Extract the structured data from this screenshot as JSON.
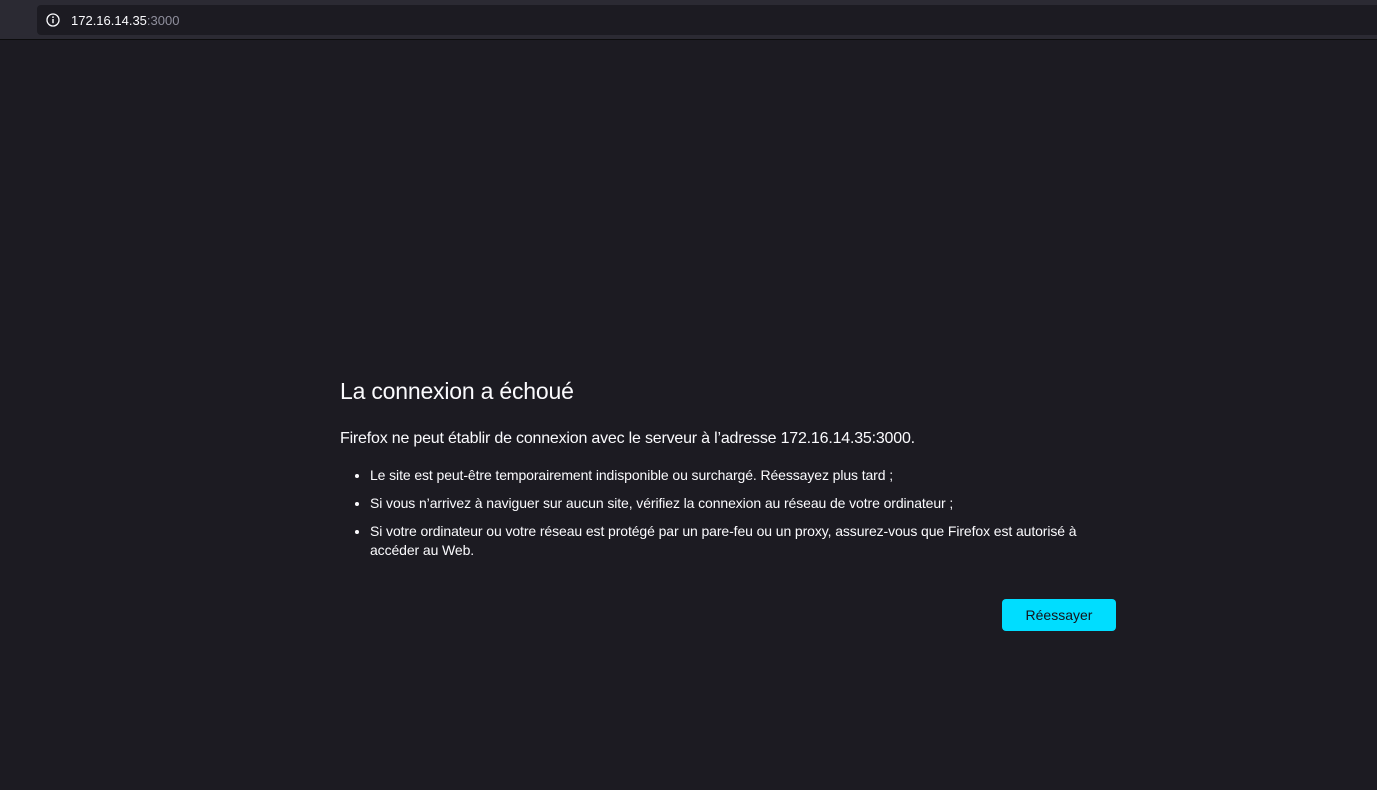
{
  "browser": {
    "url_host": "172.16.14.35",
    "url_port": ":3000",
    "info_icon": "info-icon"
  },
  "error": {
    "title": "La connexion a échoué",
    "description": "Firefox ne peut établir de connexion avec le serveur à l’adresse 172.16.14.35:3000.",
    "bullets": [
      "Le site est peut-être temporairement indisponible ou surchargé. Réessayez plus tard ;",
      "Si vous n’arrivez à naviguer sur aucun site, vérifiez la connexion au réseau de votre ordinateur ;",
      "Si votre ordinateur ou votre réseau est protégé par un pare-feu ou un proxy, assurez-vous que Firefox est autorisé à accéder au Web."
    ],
    "retry_label": "Réessayer"
  },
  "colors": {
    "background": "#1c1b22",
    "accent_button": "#00ddff",
    "text": "#fbfbfe"
  }
}
